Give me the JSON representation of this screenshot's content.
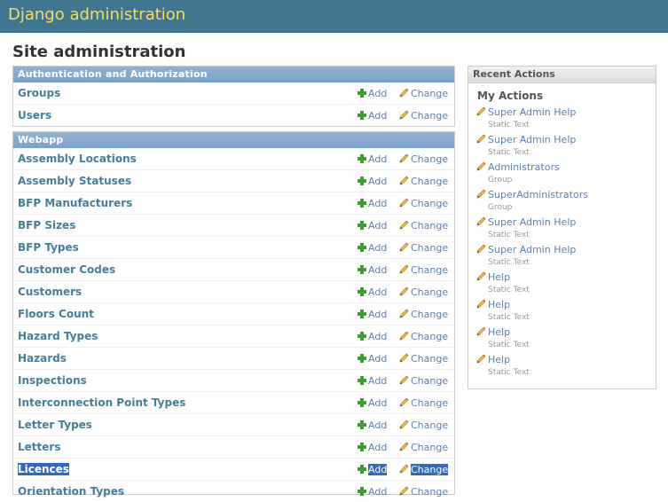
{
  "header": {
    "site_name": "Django administration"
  },
  "page": {
    "title": "Site administration"
  },
  "apps": [
    {
      "caption": "Authentication and Authorization",
      "models": [
        {
          "name": "Groups",
          "add": "Add",
          "change": "Change"
        },
        {
          "name": "Users",
          "add": "Add",
          "change": "Change"
        }
      ]
    },
    {
      "caption": "Webapp",
      "models": [
        {
          "name": "Assembly Locations",
          "add": "Add",
          "change": "Change"
        },
        {
          "name": "Assembly Statuses",
          "add": "Add",
          "change": "Change"
        },
        {
          "name": "BFP Manufacturers",
          "add": "Add",
          "change": "Change"
        },
        {
          "name": "BFP Sizes",
          "add": "Add",
          "change": "Change"
        },
        {
          "name": "BFP Types",
          "add": "Add",
          "change": "Change"
        },
        {
          "name": "Customer Codes",
          "add": "Add",
          "change": "Change"
        },
        {
          "name": "Customers",
          "add": "Add",
          "change": "Change"
        },
        {
          "name": "Floors Count",
          "add": "Add",
          "change": "Change"
        },
        {
          "name": "Hazard Types",
          "add": "Add",
          "change": "Change"
        },
        {
          "name": "Hazards",
          "add": "Add",
          "change": "Change"
        },
        {
          "name": "Inspections",
          "add": "Add",
          "change": "Change"
        },
        {
          "name": "Interconnection Point Types",
          "add": "Add",
          "change": "Change"
        },
        {
          "name": "Letter Types",
          "add": "Add",
          "change": "Change"
        },
        {
          "name": "Letters",
          "add": "Add",
          "change": "Change"
        },
        {
          "name": "Licences",
          "add": "Add",
          "change": "Change",
          "selected": true
        },
        {
          "name": "Orientation Types",
          "add": "Add",
          "change": "Change"
        }
      ]
    }
  ],
  "recent": {
    "caption": "Recent Actions",
    "subtitle": "My Actions",
    "actions": [
      {
        "label": "Super Admin Help",
        "type": "Static Text"
      },
      {
        "label": "Super Admin Help",
        "type": "Static Text"
      },
      {
        "label": "Administrators",
        "type": "Group"
      },
      {
        "label": "SuperAdministrators",
        "type": "Group"
      },
      {
        "label": "Super Admin Help",
        "type": "Static Text"
      },
      {
        "label": "Super Admin Help",
        "type": "Static Text"
      },
      {
        "label": "Help",
        "type": "Static Text"
      },
      {
        "label": "Help",
        "type": "Static Text"
      },
      {
        "label": "Help",
        "type": "Static Text"
      },
      {
        "label": "Help",
        "type": "Static Text"
      }
    ]
  },
  "colors": {
    "header_bg": "#417690",
    "site_name": "#f5dd5d",
    "caption_bg": "#7ca0c7",
    "link": "#5b80b2",
    "model_link": "#447e9b",
    "selection": "#3168c4"
  },
  "icons": {
    "add": "plus-icon",
    "change": "pencil-icon"
  }
}
